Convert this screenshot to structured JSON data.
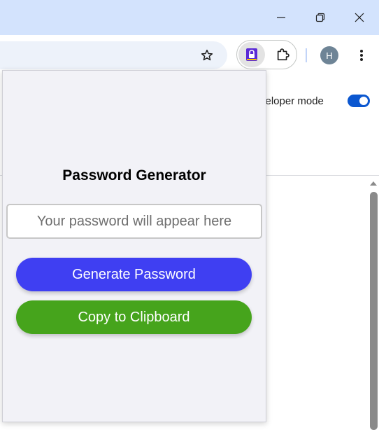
{
  "browser": {
    "avatar_initial": "H"
  },
  "background_page": {
    "developer_mode_label": "veloper mode",
    "developer_mode_on": true
  },
  "popup": {
    "title": "Password Generator",
    "password_placeholder": "Your password will appear here",
    "password_value": "",
    "generate_label": "Generate Password",
    "copy_label": "Copy to Clipboard"
  },
  "colors": {
    "titlebar": "#d3e3fd",
    "generate_button": "#3f3ff2",
    "copy_button": "#46a41c",
    "popup_background": "#f2f2f7",
    "toggle_on": "#0b57d0"
  },
  "icons": {
    "minimize": "minimize-icon",
    "restore": "restore-icon",
    "close": "close-icon",
    "bookmark": "star-icon",
    "extension_active": "lock-icon",
    "extensions": "puzzle-icon",
    "menu": "kebab-menu-icon"
  }
}
